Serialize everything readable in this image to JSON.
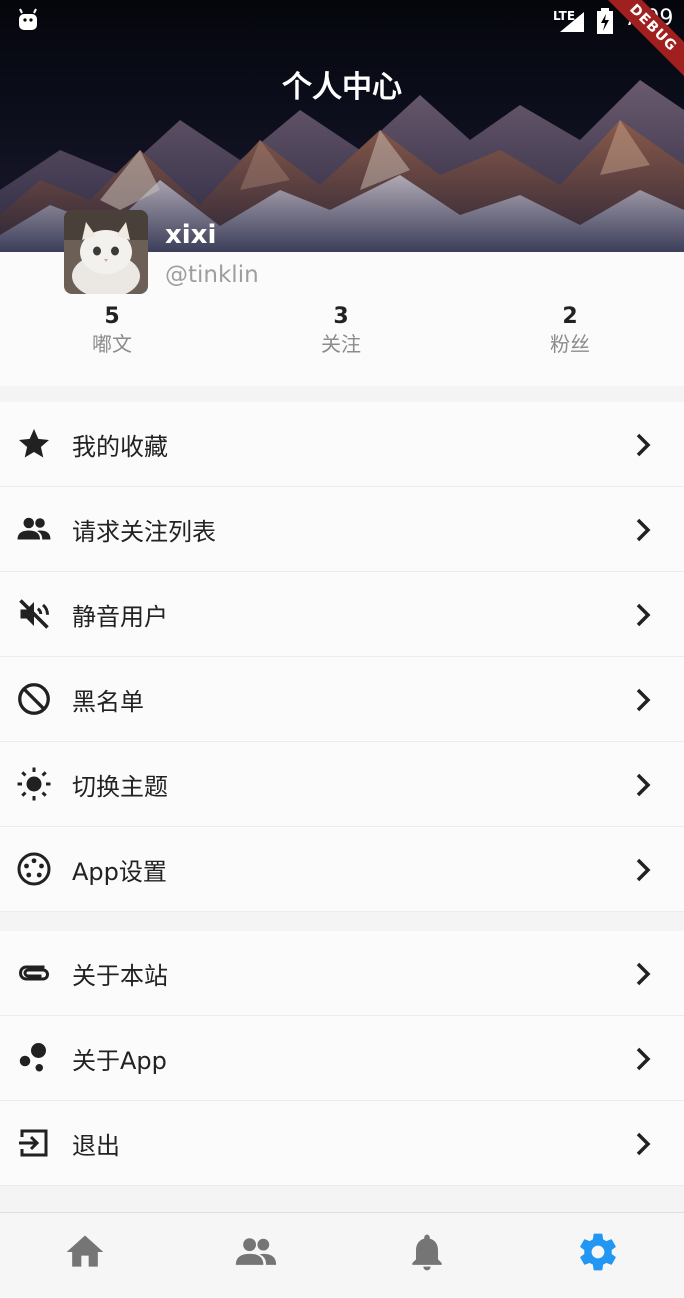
{
  "status_bar": {
    "network": "LTE",
    "time": "7:09",
    "debug_badge": "DEBUG"
  },
  "header": {
    "title": "个人中心"
  },
  "profile": {
    "name": "xixi",
    "handle": "@tinklin"
  },
  "stats": [
    {
      "value": "5",
      "label": "嘟文"
    },
    {
      "value": "3",
      "label": "关注"
    },
    {
      "value": "2",
      "label": "粉丝"
    }
  ],
  "menu_group_1": [
    {
      "label": "我的收藏",
      "icon": "star-icon"
    },
    {
      "label": "请求关注列表",
      "icon": "people-icon"
    },
    {
      "label": "静音用户",
      "icon": "volume-off-icon"
    },
    {
      "label": "黑名单",
      "icon": "block-icon"
    },
    {
      "label": "切换主题",
      "icon": "brightness-icon"
    },
    {
      "label": "App设置",
      "icon": "app-settings-icon"
    }
  ],
  "menu_group_2": [
    {
      "label": "关于本站",
      "icon": "paperclip-icon"
    },
    {
      "label": "关于App",
      "icon": "bubbles-icon"
    },
    {
      "label": "退出",
      "icon": "exit-icon"
    }
  ],
  "bottom_nav": [
    {
      "icon": "home-icon",
      "active": false
    },
    {
      "icon": "people-icon",
      "active": false
    },
    {
      "icon": "bell-icon",
      "active": false
    },
    {
      "icon": "gear-icon",
      "active": true
    }
  ],
  "colors": {
    "active_tab": "#2196f3",
    "inactive_tab": "#757575"
  }
}
